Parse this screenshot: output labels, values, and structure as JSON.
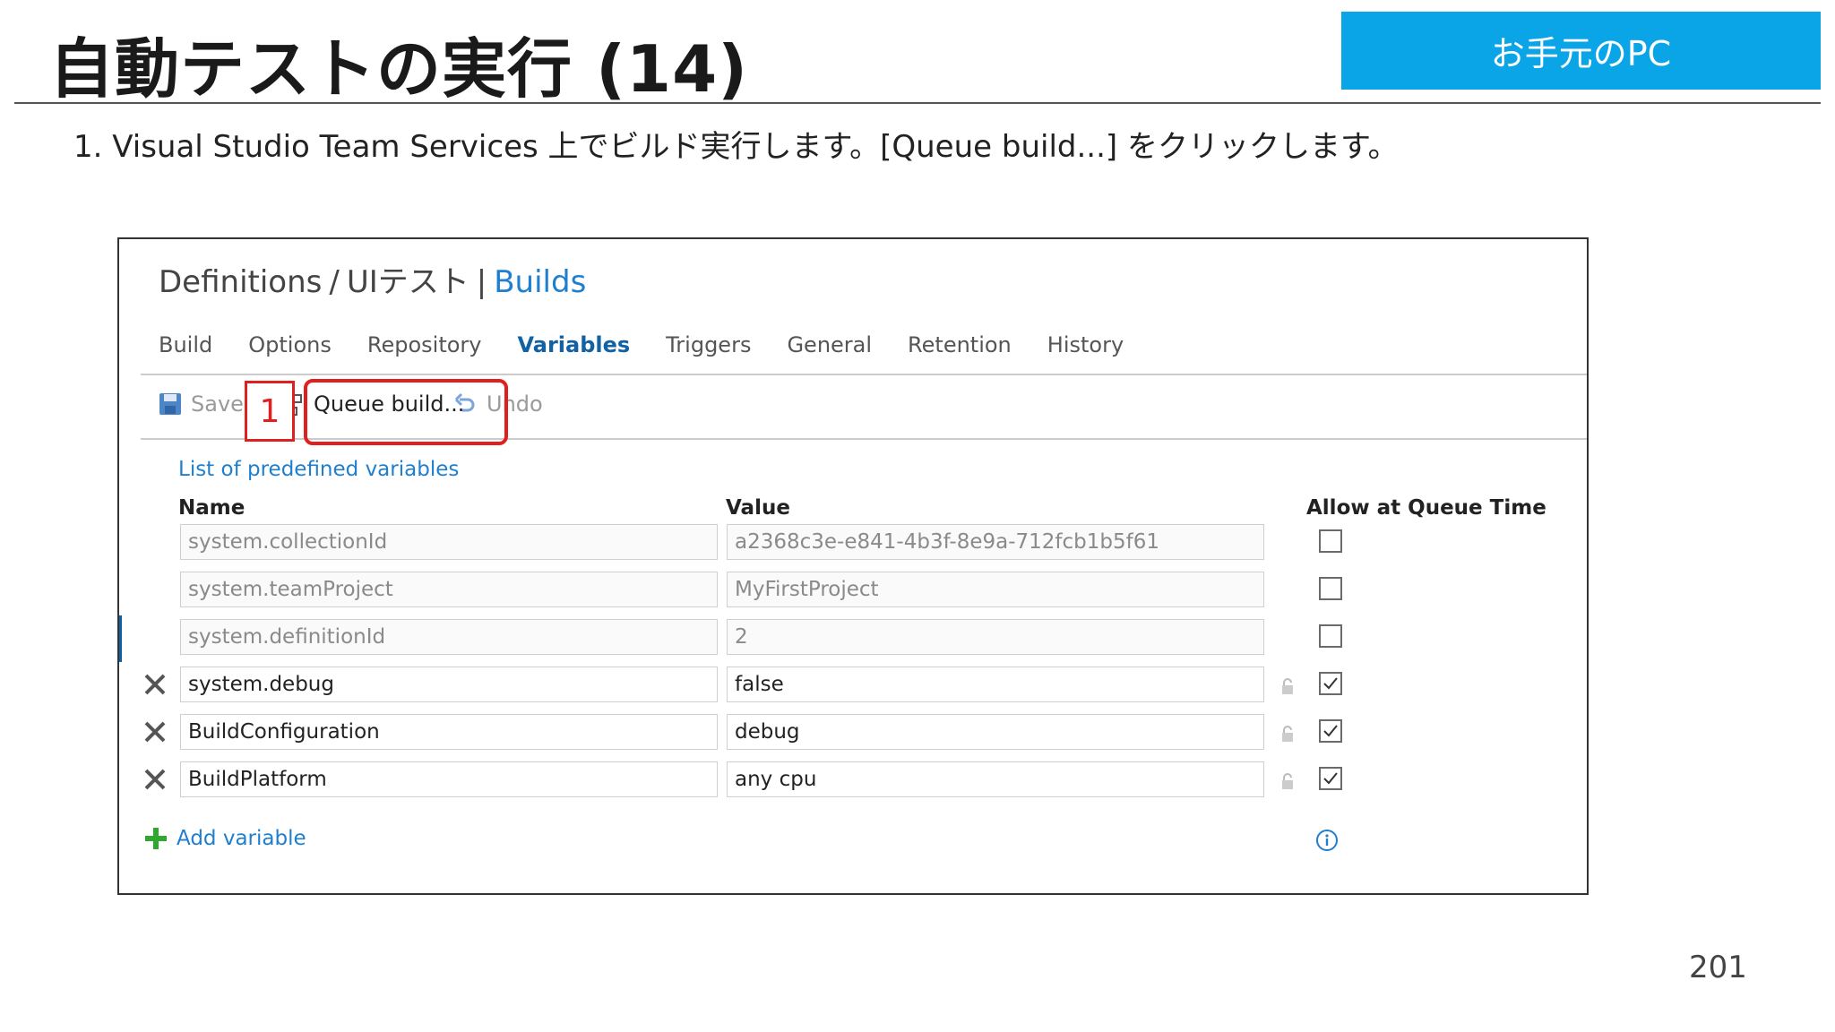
{
  "slide": {
    "title": "自動テストの実行 (14)",
    "badge": "お手元のPC",
    "instruction": "1.  Visual Studio Team Services 上でビルド実行します。[Queue build...] をクリックします。",
    "page_number": "201"
  },
  "window": {
    "breadcrumb": {
      "part1": "Definitions",
      "sep1": "/",
      "part2": "UIテスト",
      "sep2": "|",
      "link": "Builds"
    },
    "tabs": [
      {
        "label": "Build"
      },
      {
        "label": "Options"
      },
      {
        "label": "Repository"
      },
      {
        "label": "Variables",
        "active": true
      },
      {
        "label": "Triggers"
      },
      {
        "label": "General"
      },
      {
        "label": "Retention"
      },
      {
        "label": "History"
      }
    ],
    "toolbar": {
      "save_label": "Save",
      "queue_label": "Queue build...",
      "undo_label": "Undo"
    },
    "annotation_number": "1",
    "predefined_link": "List of predefined variables",
    "columns": {
      "name": "Name",
      "value": "Value",
      "allow": "Allow at Queue Time"
    },
    "variables": [
      {
        "name": "system.collectionId",
        "value": "a2368c3e-e841-4b3f-8e9a-712fcb1b5f61",
        "allow": false,
        "deletable": false
      },
      {
        "name": "system.teamProject",
        "value": "MyFirstProject",
        "allow": false,
        "deletable": false
      },
      {
        "name": "system.definitionId",
        "value": "2",
        "allow": false,
        "deletable": false
      },
      {
        "name": "system.debug",
        "value": "false",
        "allow": true,
        "deletable": true
      },
      {
        "name": "BuildConfiguration",
        "value": "debug",
        "allow": true,
        "deletable": true
      },
      {
        "name": "BuildPlatform",
        "value": "any cpu",
        "allow": true,
        "deletable": true
      }
    ],
    "add_variable_label": "Add variable"
  },
  "colors": {
    "badge": "#0aa5e6",
    "link": "#1f7fcf",
    "active_tab": "#1161a5",
    "highlight": "#e01f1f",
    "add_icon": "#2ea82e"
  },
  "icons": {
    "save": "save-icon",
    "queue": "queue-build-icon",
    "undo": "undo-icon",
    "delete": "delete-x-icon",
    "lock": "lock-icon",
    "add": "plus-icon",
    "info": "info-icon"
  }
}
